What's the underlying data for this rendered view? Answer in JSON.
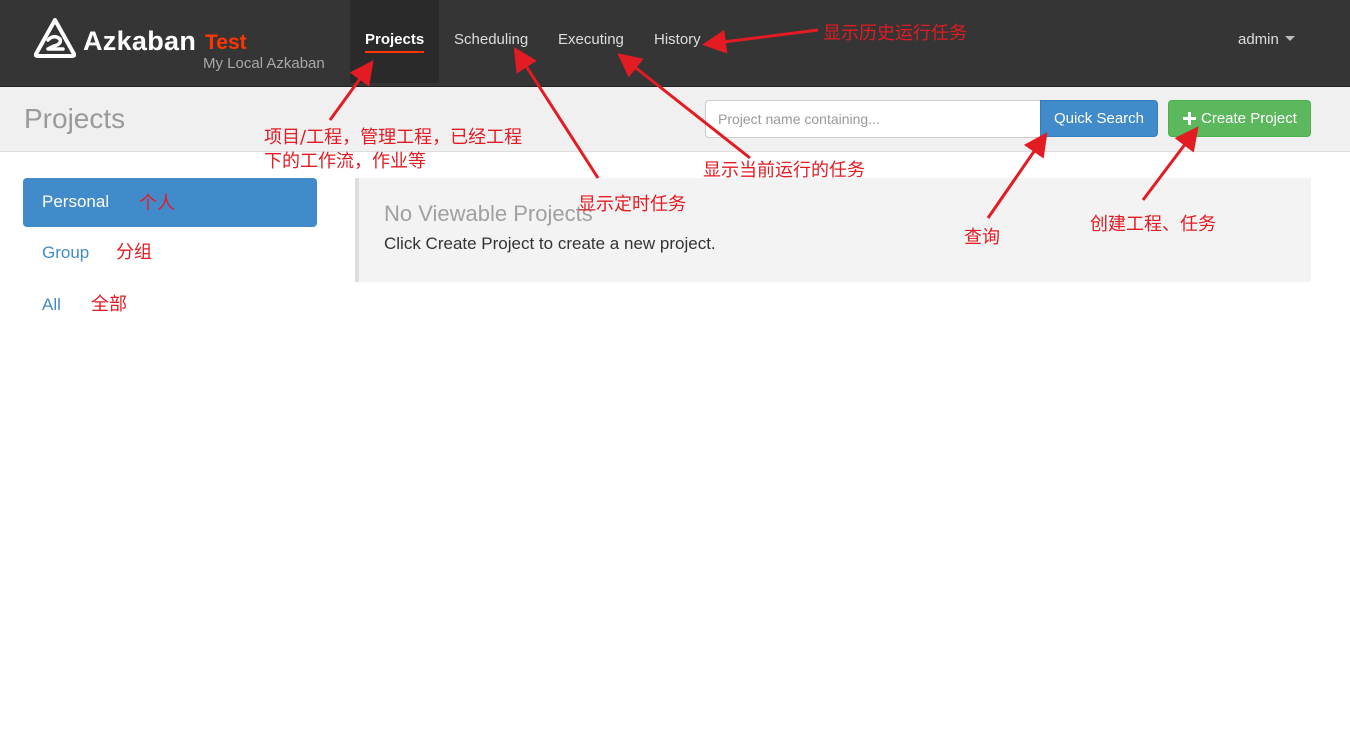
{
  "app": {
    "brand_name": "Azkaban",
    "brand_env": "Test",
    "brand_subtitle": "My Local Azkaban"
  },
  "nav": {
    "items": [
      {
        "label": "Projects",
        "active": true
      },
      {
        "label": "Scheduling"
      },
      {
        "label": "Executing"
      },
      {
        "label": "History"
      }
    ],
    "user": "admin"
  },
  "header": {
    "title": "Projects",
    "search_placeholder": "Project name containing...",
    "search_button": "Quick Search",
    "create_button": "Create Project"
  },
  "sidebar": {
    "items": [
      {
        "label": "Personal",
        "active": true
      },
      {
        "label": "Group"
      },
      {
        "label": "All"
      }
    ]
  },
  "main": {
    "empty_title": "No Viewable Projects",
    "empty_text": "Click Create Project to create a new project."
  },
  "annotations": {
    "history": "显示历史运行任务",
    "projects_line1": "项目/工程，管理工程，已经工程",
    "projects_line2": "下的工作流，作业等",
    "executing": "显示当前运行的任务",
    "scheduling": "显示定时任务",
    "search": "查询",
    "create": "创建工程、任务",
    "personal": "个人",
    "group": "分组",
    "all": "全部"
  },
  "colors": {
    "navbar": "#353535",
    "brand_env": "#ff3601",
    "primary": "#428bca",
    "success": "#5cb85c",
    "annotation": "#e31b23"
  }
}
